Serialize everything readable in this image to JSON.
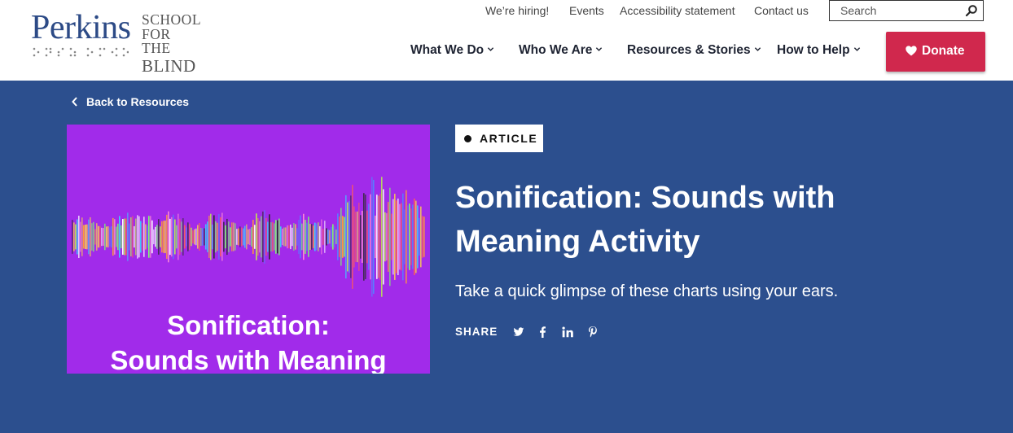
{
  "brand": {
    "logo_word": "Perkins",
    "logo_line1": "SCHOOL",
    "logo_line2": "FOR THE",
    "logo_line3": "BLIND"
  },
  "utility_nav": {
    "links": [
      "We’re hiring!",
      "Events",
      "Accessibility statement",
      "Contact us"
    ],
    "search_placeholder": "Search"
  },
  "main_nav": {
    "items": [
      "What We Do",
      "Who We Are",
      "Resources & Stories",
      "How to Help"
    ],
    "donate_label": "Donate"
  },
  "colors": {
    "hero_bg": "#2c4f8e",
    "brand_blue": "#2c4a86",
    "donate_red": "#d0284d",
    "thumbnail_purple": "#a12bea"
  },
  "hero": {
    "back_link": "Back to Resources",
    "badge": "ARTICLE",
    "title": "Sonification: Sounds with Meaning Activity",
    "subtitle": "Take a quick glimpse of these charts using your ears.",
    "share_label": "SHARE",
    "share_icons": [
      "twitter-icon",
      "facebook-icon",
      "linkedin-icon",
      "pinterest-icon"
    ],
    "image": {
      "caption_line1": "Sonification:",
      "caption_line2": "Sounds with Meaning"
    }
  }
}
